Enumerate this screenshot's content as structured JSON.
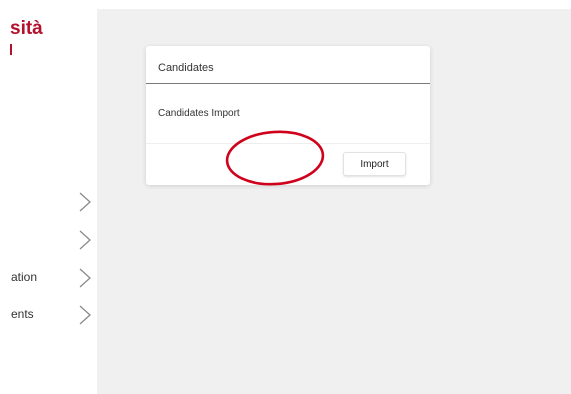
{
  "sidebar": {
    "brand_line1": "sità",
    "items": [
      {
        "label": ""
      },
      {
        "label": ""
      },
      {
        "label": "ation"
      },
      {
        "label": "ents"
      }
    ]
  },
  "modal": {
    "title": "Candidates",
    "body_text": "Candidates Import",
    "import_label": "Import"
  },
  "colors": {
    "brand": "#b3112e",
    "annotation": "#d0021b",
    "main_background": "#f0f0f0"
  },
  "icons": {
    "nav_chevron": "chevron-right-icon"
  }
}
